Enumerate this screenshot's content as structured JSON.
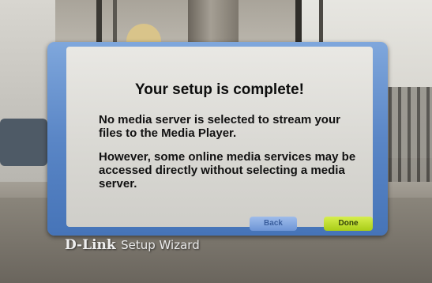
{
  "dialog": {
    "title": "Your setup is complete!",
    "message_1": "No media server is selected to stream your files to the Media Player.",
    "message_2": "However, some online media services may be accessed directly without selecting a media server.",
    "back_label": "Back",
    "done_label": "Done"
  },
  "brand": {
    "logo": "D-Link",
    "subtitle": "Setup Wizard"
  },
  "colors": {
    "frame_blue": "#5a86c6",
    "back_button": "#6d95d6",
    "done_button": "#a9cd17"
  }
}
